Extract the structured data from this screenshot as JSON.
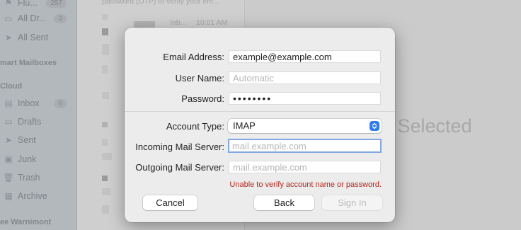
{
  "sidebar": {
    "items_top": [
      {
        "label": "Flu...",
        "badge": "257",
        "icon": "flag-icon"
      },
      {
        "label": "All Dr...",
        "badge": "3",
        "icon": "doc-icon"
      },
      {
        "label": "All Sent",
        "badge": "",
        "icon": "paperplane-icon"
      }
    ],
    "smart_mailboxes_header": "mart Mailboxes",
    "icloud_header": "Cloud",
    "items_icloud": [
      {
        "label": "Inbox",
        "badge": "6",
        "icon": "tray-icon"
      },
      {
        "label": "Drafts",
        "badge": "",
        "icon": "doc-icon"
      },
      {
        "label": "Sent",
        "badge": "",
        "icon": "paperplane-icon"
      },
      {
        "label": "Junk",
        "badge": "",
        "icon": "junk-icon"
      },
      {
        "label": "Trash",
        "badge": "",
        "icon": "trash-icon"
      },
      {
        "label": "Archive",
        "badge": "",
        "icon": "archive-icon"
      }
    ],
    "account_footer": "ee Warnimont"
  },
  "message_list": {
    "top_snippet": "password (OTP) to verify your em...",
    "row1_mailbox": "Inb...",
    "row1_time": "10:01 AM"
  },
  "reader": {
    "empty_text": "e Selected"
  },
  "dialog": {
    "email_label": "Email Address:",
    "email_value": "example@example.com",
    "username_label": "User Name:",
    "username_placeholder": "Automatic",
    "password_label": "Password:",
    "password_value": "••••••••",
    "account_type_label": "Account Type:",
    "account_type_value": "IMAP",
    "incoming_label": "Incoming Mail Server:",
    "incoming_placeholder": "mail.example.com",
    "outgoing_label": "Outgoing Mail Server:",
    "outgoing_placeholder": "mail.example.com",
    "error_text": "Unable to verify account name or password.",
    "cancel_label": "Cancel",
    "back_label": "Back",
    "signin_label": "Sign In"
  },
  "colors": {
    "accent": "#2f7cf6",
    "focus_ring": "#82a9e3",
    "error": "#b6281d"
  }
}
